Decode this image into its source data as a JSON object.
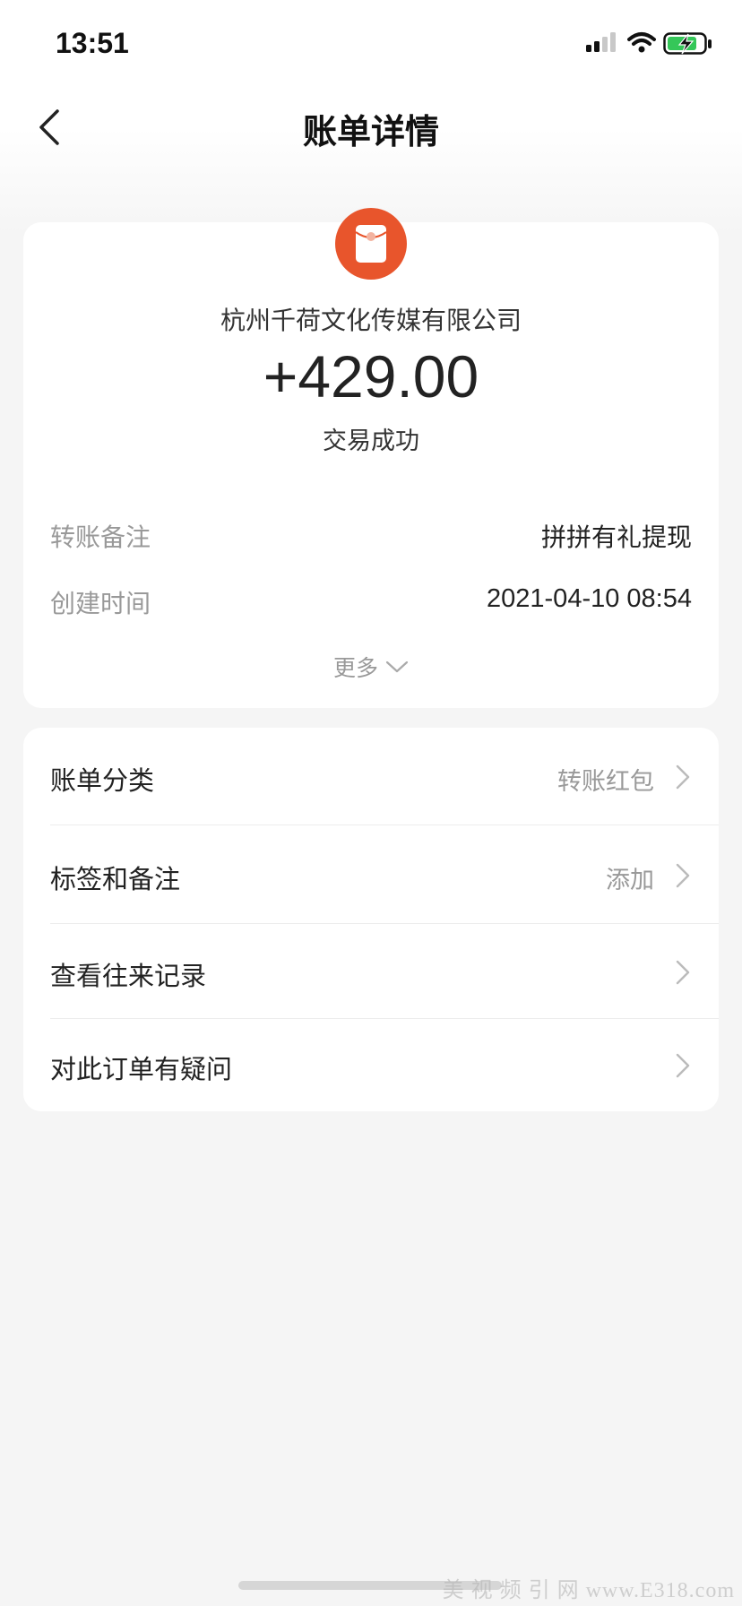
{
  "status_bar": {
    "time": "13:51",
    "icons": [
      "signal-icon",
      "wifi-icon",
      "battery-charging-icon"
    ]
  },
  "nav": {
    "title": "账单详情",
    "back_icon": "chevron-left-icon"
  },
  "summary": {
    "icon": "red-packet-icon",
    "merchant": "杭州千荷文化传媒有限公司",
    "amount": "+429.00",
    "status": "交易成功",
    "details": [
      {
        "label": "转账备注",
        "value": "拼拼有礼提现"
      },
      {
        "label": "创建时间",
        "value": "2021-04-10 08:54"
      }
    ],
    "more_label": "更多"
  },
  "actions": [
    {
      "label": "账单分类",
      "value": "转账红包"
    },
    {
      "label": "标签和备注",
      "value": "添加"
    },
    {
      "label": "查看往来记录",
      "value": ""
    },
    {
      "label": "对此订单有疑问",
      "value": ""
    }
  ],
  "watermark": "美 视 频 引 网 www.E318.com",
  "colors": {
    "accent": "#e8552c",
    "background": "#f5f5f5",
    "card": "#ffffff",
    "muted_text": "#999999"
  }
}
